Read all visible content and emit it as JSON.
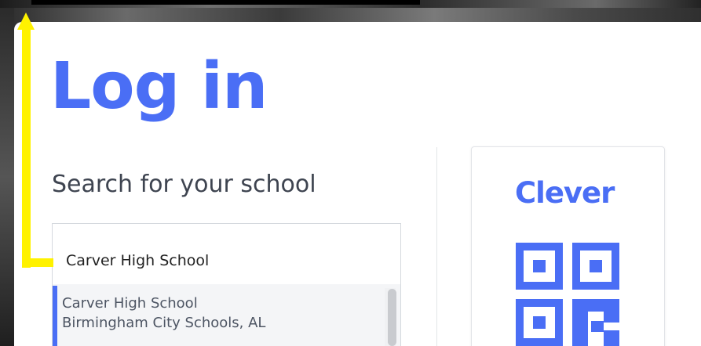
{
  "login": {
    "title": "Log in"
  },
  "search": {
    "label": "Search for your school",
    "value": "Carver High School"
  },
  "results": [
    {
      "name": "Carver High School",
      "district": "Birmingham City Schools, AL"
    }
  ],
  "clever": {
    "logo_text": "Clever",
    "qr_icon": "qr-code-icon"
  },
  "annotation": {
    "arrow_color": "#fff200",
    "icon": "arrow-up-icon"
  },
  "colors": {
    "accent": "#4a6ef5",
    "text": "#3e4450"
  }
}
